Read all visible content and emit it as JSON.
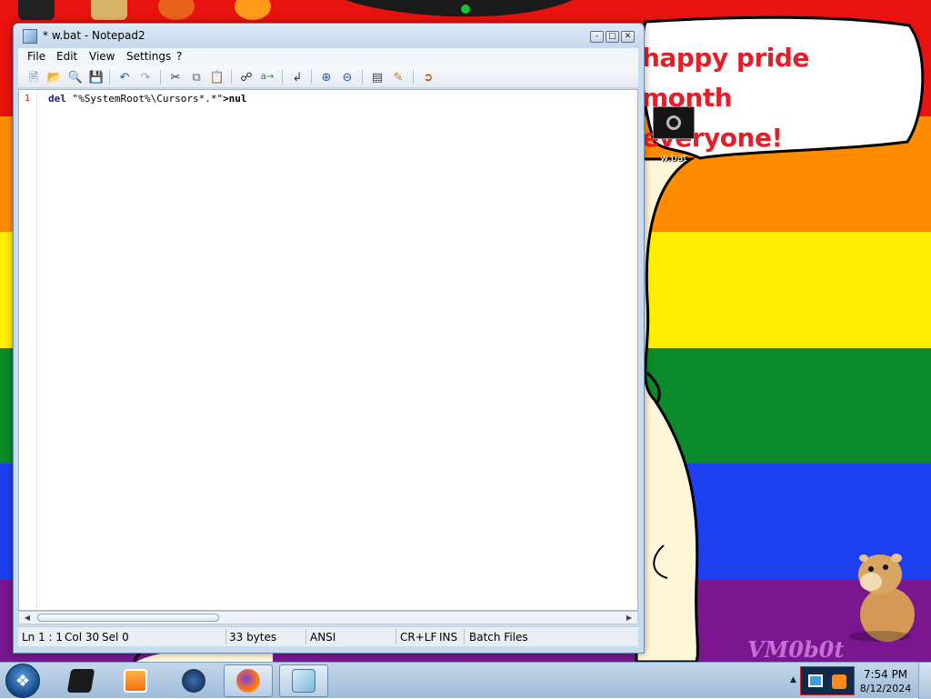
{
  "desktop": {
    "speech_bubble_line1": "happy pride month",
    "speech_bubble_line2": "everyone!",
    "icon_label": "w.bat",
    "watermark": "VM0b0t",
    "stripe_colors": [
      "#e8120e",
      "#ff8c00",
      "#ffee00",
      "#0a8a28",
      "#1e3ff0",
      "#7b1590"
    ]
  },
  "window": {
    "title": "* w.bat - Notepad2",
    "menu": [
      "File",
      "Edit",
      "View",
      "Settings",
      "?"
    ],
    "toolbar_icons": [
      "new-file-icon",
      "open-icon",
      "browse-icon",
      "save-icon",
      "undo-icon",
      "redo-icon",
      "cut-icon",
      "copy-icon",
      "paste-icon",
      "find-icon",
      "replace-icon",
      "word-wrap-icon",
      "zoom-in-icon",
      "zoom-out-icon",
      "select-scheme-icon",
      "customize-scheme-icon",
      "exit-icon"
    ]
  },
  "editor": {
    "line_number": "1",
    "code_keyword": "del",
    "code_string": " \"%SystemRoot%\\Cursors*.*\"",
    "code_tail": ">nul"
  },
  "statusbar": {
    "position": "Ln 1 : 1",
    "column": "Col 30",
    "selection": "Sel 0",
    "size": "33 bytes",
    "encoding": "ANSI",
    "line_endings": "CR+LF",
    "insert_mode": "INS",
    "scheme": "Batch Files"
  },
  "taskbar": {
    "apps": [
      "terminal-app-icon",
      "media-player-app-icon",
      "browser-globe-app-icon",
      "firefox-app-icon",
      "notepad2-app-icon"
    ],
    "time": "7:54 PM",
    "date": "8/12/2024"
  }
}
